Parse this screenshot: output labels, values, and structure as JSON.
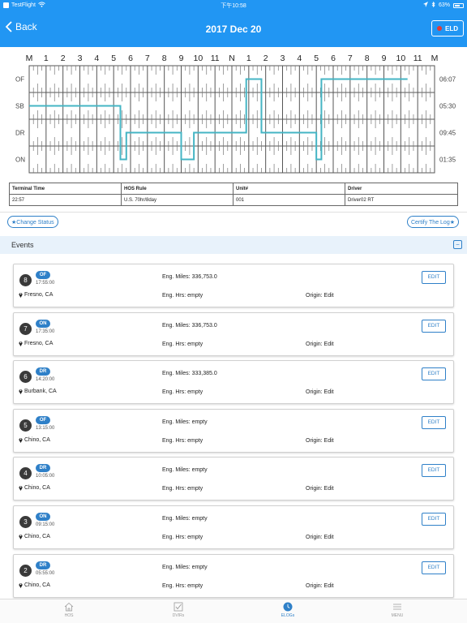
{
  "status_bar": {
    "app": "TestFlight",
    "time": "下午10:58",
    "battery": "63%",
    "battery_level": 0.63
  },
  "nav": {
    "back_label": "Back",
    "title": "2017 Dec 20",
    "eld_label": "ELD"
  },
  "log_grid": {
    "hour_labels": [
      "M",
      "1",
      "2",
      "3",
      "4",
      "5",
      "6",
      "7",
      "8",
      "9",
      "10",
      "11",
      "N",
      "1",
      "2",
      "3",
      "4",
      "5",
      "6",
      "7",
      "8",
      "9",
      "10",
      "11",
      "M"
    ],
    "rows": [
      {
        "code": "OF",
        "total": "06:07"
      },
      {
        "code": "SB",
        "total": "05:30"
      },
      {
        "code": "DR",
        "total": "09:45"
      },
      {
        "code": "ON",
        "total": "01:35"
      }
    ],
    "line_color": "#45b5c4",
    "duty_segments": [
      {
        "status": "SB",
        "start": 0,
        "end": 5.4
      },
      {
        "status": "ON",
        "start": 5.4,
        "end": 5.75
      },
      {
        "status": "DR",
        "start": 5.75,
        "end": 9.0
      },
      {
        "status": "ON",
        "start": 9.0,
        "end": 9.75
      },
      {
        "status": "DR",
        "start": 9.75,
        "end": 12.85
      },
      {
        "status": "OF",
        "start": 12.85,
        "end": 13.75
      },
      {
        "status": "DR",
        "start": 13.75,
        "end": 17.0
      },
      {
        "status": "ON",
        "start": 17.0,
        "end": 17.3
      },
      {
        "status": "OF",
        "start": 17.3,
        "end": 22.4
      }
    ]
  },
  "info_table": {
    "headers": [
      "Terminal Time",
      "HOS Rule",
      "Unit#",
      "Driver"
    ],
    "values": [
      "22:57",
      "U.S. 70hr/8day",
      "001",
      "Driver02 RT"
    ]
  },
  "actions": {
    "change_status": "★Change Status",
    "certify": "Certify The Log★"
  },
  "events": {
    "title": "Events",
    "collapse_symbol": "−",
    "edit_label": "EDIT",
    "items": [
      {
        "num": "8",
        "status": "OF",
        "time": "17:55:00",
        "location": "Fresno, CA",
        "miles": "Eng. Miles: 336,753.0",
        "hours": "Eng. Hrs: empty",
        "origin": "Origin: Edit"
      },
      {
        "num": "7",
        "status": "ON",
        "time": "17:35:00",
        "location": "Fresno, CA",
        "miles": "Eng. Miles: 336,753.0",
        "hours": "Eng. Hrs: empty",
        "origin": "Origin: Edit"
      },
      {
        "num": "6",
        "status": "DR",
        "time": "14:20:00",
        "location": "Burbank, CA",
        "miles": "Eng. Miles: 333,385.0",
        "hours": "Eng. Hrs: empty",
        "origin": "Origin: Edit"
      },
      {
        "num": "5",
        "status": "OF",
        "time": "13:15:00",
        "location": "Chino, CA",
        "miles": "Eng. Miles: empty",
        "hours": "Eng. Hrs: empty",
        "origin": "Origin: Edit"
      },
      {
        "num": "4",
        "status": "DR",
        "time": "10:05:00",
        "location": "Chino, CA",
        "miles": "Eng. Miles: empty",
        "hours": "Eng. Hrs: empty",
        "origin": "Origin: Edit"
      },
      {
        "num": "3",
        "status": "ON",
        "time": "09:15:00",
        "location": "Chino, CA",
        "miles": "Eng. Miles: empty",
        "hours": "Eng. Hrs: empty",
        "origin": "Origin: Edit"
      },
      {
        "num": "2",
        "status": "DR",
        "time": "05:55:00",
        "location": "Chino, CA",
        "miles": "Eng. Miles: empty",
        "hours": "Eng. Hrs: empty",
        "origin": "Origin: Edit"
      }
    ]
  },
  "tabbar": {
    "tabs": [
      {
        "label": "HOS",
        "icon": "home-icon",
        "active": false
      },
      {
        "label": "DVIRs",
        "icon": "checkbox-icon",
        "active": false
      },
      {
        "label": "ELOGs",
        "icon": "clock-icon",
        "active": true
      },
      {
        "label": "MENU",
        "icon": "menu-icon",
        "active": false
      }
    ]
  }
}
